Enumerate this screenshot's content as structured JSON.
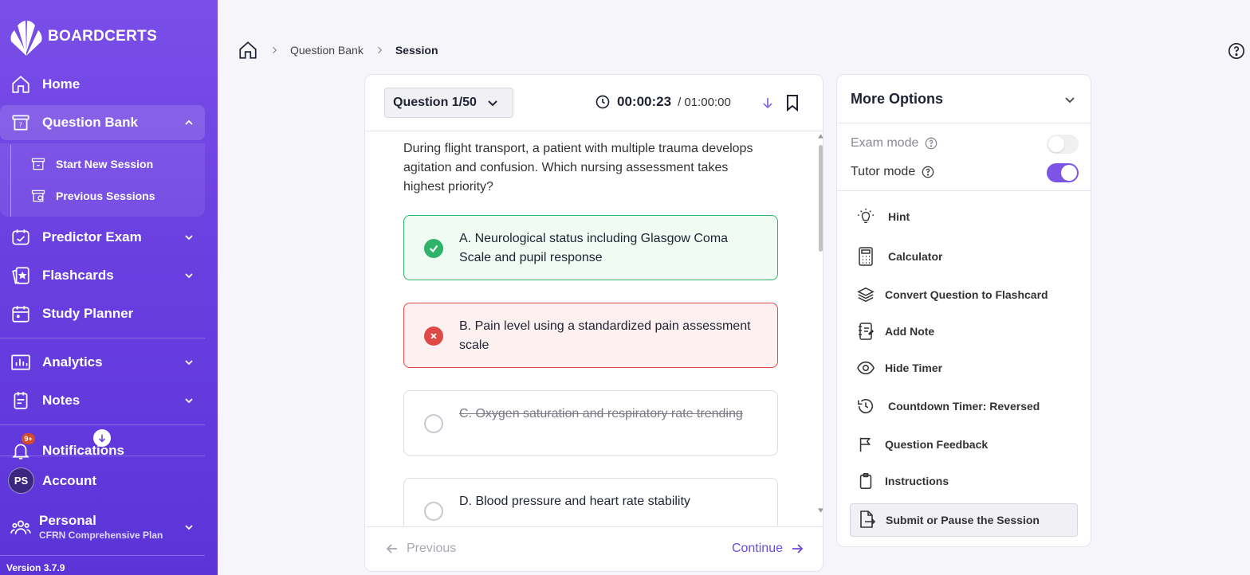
{
  "brand": {
    "name": "BOARDCERTS"
  },
  "sidebar": {
    "items": [
      {
        "label": "Home",
        "icon": "home-icon"
      },
      {
        "label": "Question Bank",
        "icon": "question-bank-icon"
      },
      {
        "label": "Predictor Exam",
        "icon": "predictor-icon"
      },
      {
        "label": "Flashcards",
        "icon": "flashcards-icon"
      },
      {
        "label": "Study Planner",
        "icon": "calendar-icon"
      },
      {
        "label": "Analytics",
        "icon": "analytics-icon"
      },
      {
        "label": "Notes",
        "icon": "notes-icon"
      },
      {
        "label": "Notifications",
        "icon": "bell-icon"
      }
    ],
    "sub_items": [
      {
        "label": "Start New Session"
      },
      {
        "label": "Previous Sessions"
      }
    ],
    "notifications_badge": "9+",
    "account": {
      "initials": "PS",
      "label": "Account"
    },
    "plan": {
      "name": "Personal",
      "subtitle": "CFRN Comprehensive Plan"
    },
    "version": "Version 3.7.9"
  },
  "breadcrumb": {
    "items": [
      "Question Bank",
      "Session"
    ]
  },
  "question": {
    "selector_label": "Question 1/50",
    "timer_elapsed": "00:00:23",
    "timer_total": "/ 01:00:00",
    "text": "During flight transport, a patient with multiple trauma develops agitation and confusion. Which nursing assessment takes highest priority?",
    "options": [
      {
        "text": "A. Neurological status including Glasgow Coma Scale and pupil response",
        "state": "correct"
      },
      {
        "text": "B. Pain level using a standardized pain assessment scale",
        "state": "wrong"
      },
      {
        "text": "C. Oxygen saturation and respiratory rate trending",
        "state": "struck"
      },
      {
        "text": "D. Blood pressure and heart rate stability",
        "state": "none"
      }
    ],
    "previous_label": "Previous",
    "continue_label": "Continue"
  },
  "more_options": {
    "title": "More Options",
    "modes": [
      {
        "label": "Exam mode",
        "on": false
      },
      {
        "label": "Tutor mode",
        "on": true
      }
    ],
    "items": [
      {
        "label": "Hint",
        "icon": "lightbulb-icon"
      },
      {
        "label": "Calculator",
        "icon": "calculator-icon"
      },
      {
        "label": "Convert Question to Flashcard",
        "icon": "layers-icon"
      },
      {
        "label": "Add Note",
        "icon": "note-icon"
      },
      {
        "label": "Hide Timer",
        "icon": "eye-icon"
      },
      {
        "label": "Countdown Timer: Reversed",
        "icon": "history-icon"
      },
      {
        "label": "Question Feedback",
        "icon": "flag-icon"
      },
      {
        "label": "Instructions",
        "icon": "clipboard-icon"
      }
    ],
    "submit_label": "Submit or Pause the Session"
  },
  "colors": {
    "accent": "#7c55e6",
    "correct": "#2fb36b",
    "wrong": "#e04848",
    "sidebar": "#6a3fe0"
  }
}
